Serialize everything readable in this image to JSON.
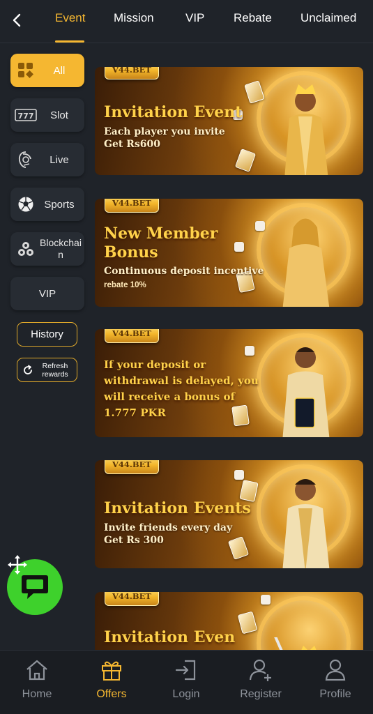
{
  "top_tabs": [
    {
      "label": "Event",
      "active": true
    },
    {
      "label": "Mission",
      "active": false
    },
    {
      "label": "VIP",
      "active": false
    },
    {
      "label": "Rebate",
      "active": false
    },
    {
      "label": "Unclaimed",
      "active": false
    }
  ],
  "sidebar": {
    "categories": [
      {
        "label": "All",
        "icon": "grid-icon",
        "active": true
      },
      {
        "label": "Slot",
        "icon": "slot-777-icon",
        "active": false
      },
      {
        "label": "Live",
        "icon": "live-dealer-icon",
        "active": false
      },
      {
        "label": "Sports",
        "icon": "soccer-ball-icon",
        "active": false
      },
      {
        "label": "Blockchain",
        "icon": "blockchain-icon",
        "active": false
      },
      {
        "label": "VIP",
        "icon": "",
        "active": false
      }
    ],
    "history_label": "History",
    "refresh_label": "Refresh rewards"
  },
  "banners": [
    {
      "badge": "V44.BET",
      "title": "Invitation Event",
      "line1": "Each player you invite",
      "line2": "Get Rs600"
    },
    {
      "badge": "V44.BET",
      "title_line1": "New Member",
      "title_line2": "Bonus",
      "line1": "Continuous deposit incentive",
      "small": "rebate 10%"
    },
    {
      "badge": "V44.BET",
      "yellow_lines": [
        "If your deposit or",
        "withdrawal is delayed, you",
        "will receive a bonus of",
        "1.777 PKR"
      ]
    },
    {
      "badge": "V44.BET",
      "title": "Invitation Events",
      "line1": "Invite friends every day",
      "line2": "Get Rs 300"
    },
    {
      "badge": "V44.BET",
      "title": "Invitation Even"
    }
  ],
  "bottom_nav": [
    {
      "label": "Home",
      "icon": "home-icon",
      "active": false
    },
    {
      "label": "Offers",
      "icon": "gift-icon",
      "active": true
    },
    {
      "label": "Login",
      "icon": "login-icon",
      "active": false
    },
    {
      "label": "Register",
      "icon": "add-user-icon",
      "active": false
    },
    {
      "label": "Profile",
      "icon": "user-icon",
      "active": false
    }
  ],
  "colors": {
    "accent": "#f5b731",
    "background": "#1f2329",
    "chat_button": "#3ed12c"
  }
}
